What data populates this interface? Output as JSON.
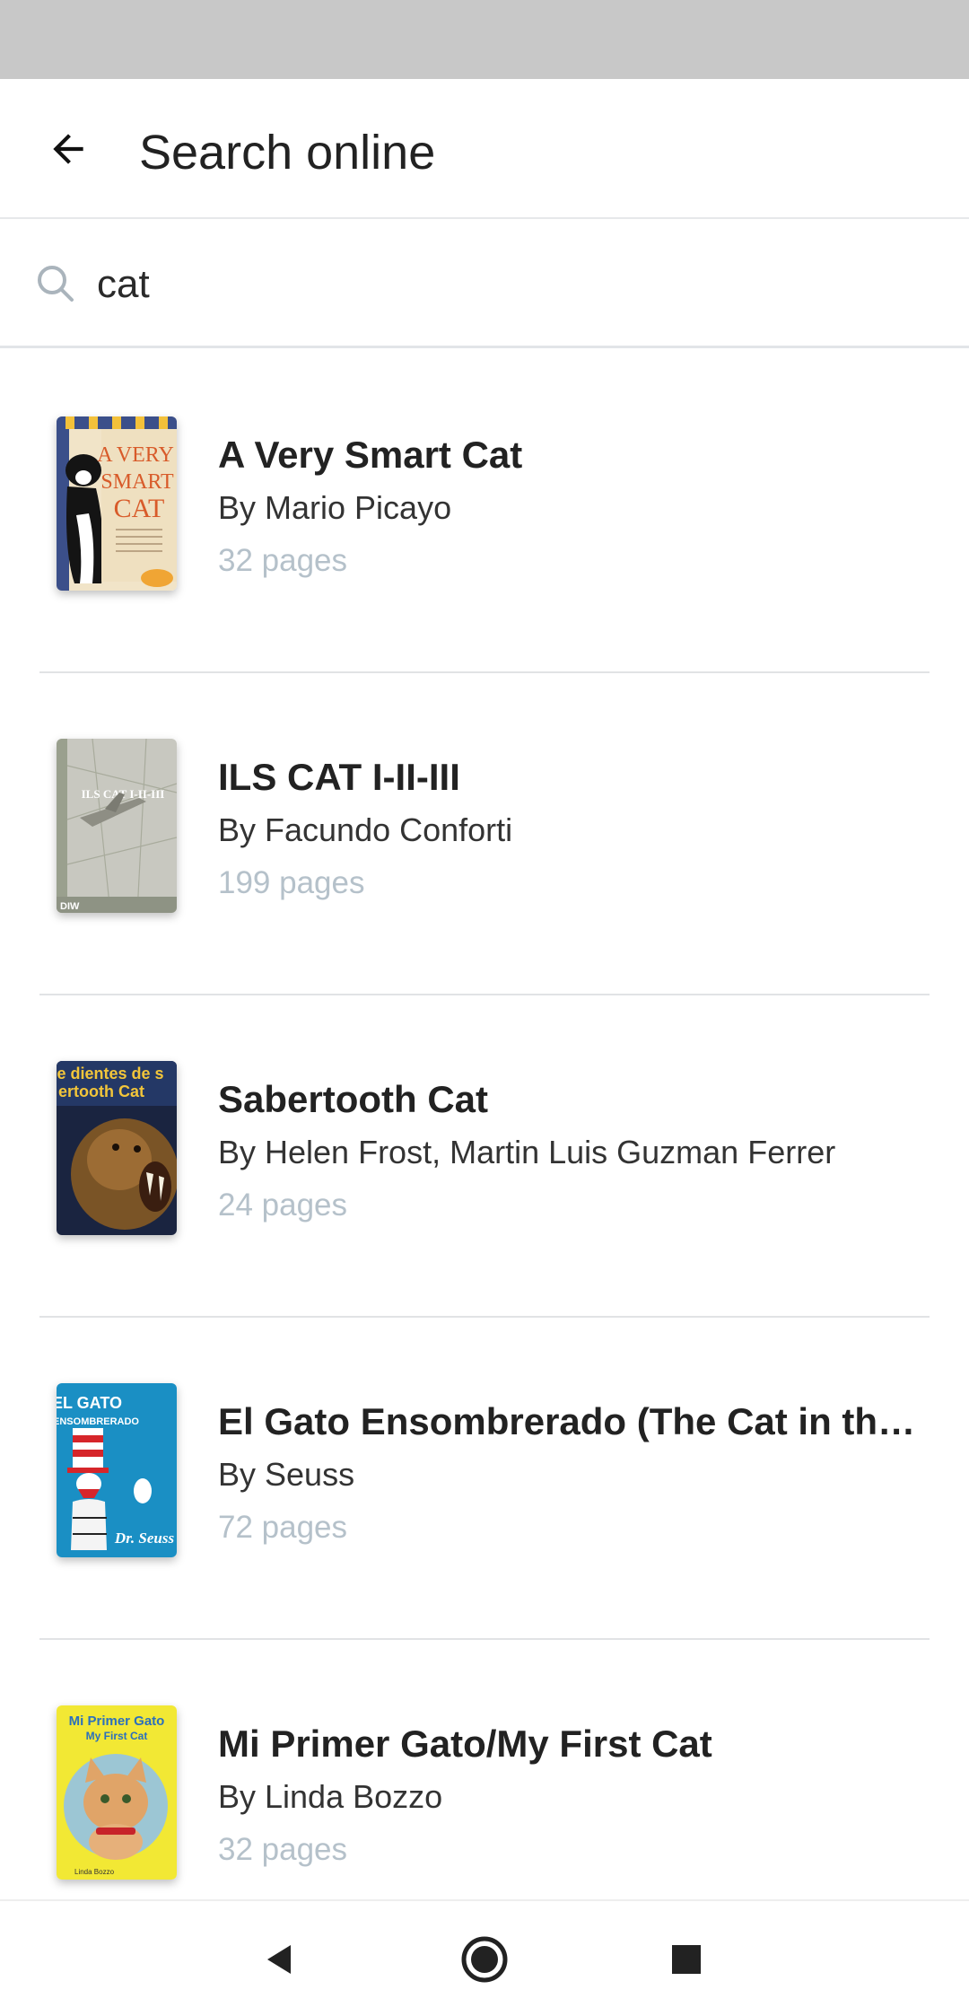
{
  "app_bar": {
    "title": "Search online"
  },
  "search": {
    "query": "cat",
    "placeholder": ""
  },
  "results": [
    {
      "title": "A Very Smart Cat",
      "author": "By Mario Picayo",
      "pages": "32 pages",
      "cover_text": [
        "A VERY",
        "SMART",
        "CAT"
      ]
    },
    {
      "title": "ILS CAT I-II-III",
      "author": "By Facundo Conforti",
      "pages": "199 pages",
      "cover_text": [
        "ILS CAT I-II-III"
      ]
    },
    {
      "title": "Sabertooth Cat",
      "author": "By Helen Frost, Martin Luis Guzman Ferrer",
      "pages": "24 pages",
      "cover_text": [
        "e dientes de s",
        "ertooth Cat"
      ]
    },
    {
      "title": "El Gato Ensombrerado (The Cat in the Hat)",
      "author": "By Seuss",
      "pages": "72 pages",
      "cover_text": [
        "EL GATO",
        "ENSOMBRERADO",
        "Dr. Seuss"
      ]
    },
    {
      "title": "Mi Primer Gato/My First Cat",
      "author": "By Linda Bozzo",
      "pages": "32 pages",
      "cover_text": [
        "Mi Primer Gato",
        "My First Cat"
      ]
    }
  ],
  "colors": {
    "status_bar": "#c8c8c8",
    "pages_text": "#b5c1ca",
    "divider": "#e1e3e5"
  },
  "icons": {
    "back": "arrow-left-icon",
    "search": "magnifier-icon",
    "nav_back": "triangle-back-icon",
    "nav_home": "circle-home-icon",
    "nav_recents": "square-recents-icon"
  }
}
